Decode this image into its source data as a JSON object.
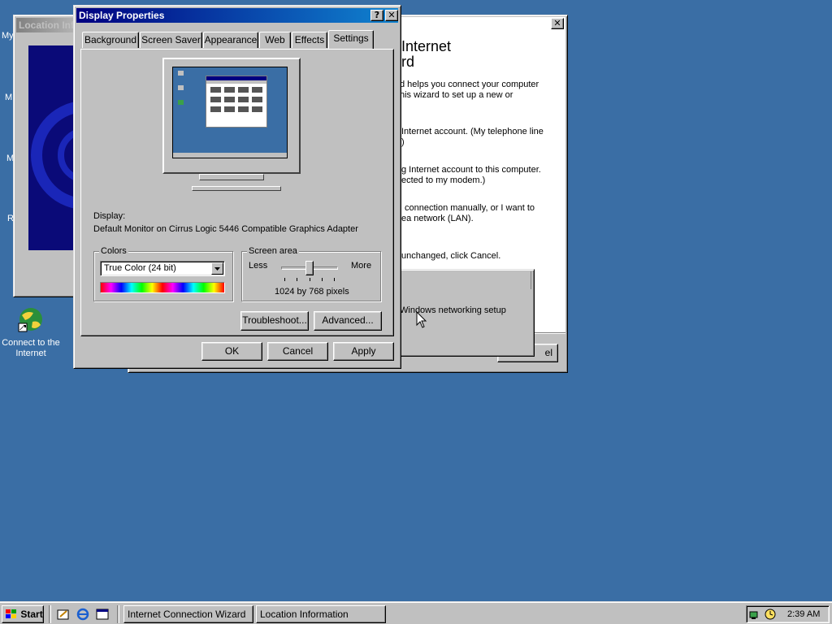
{
  "desktop": {
    "background_color": "#3a6ea5",
    "partial_icon_letters": [
      "My",
      "M",
      "M",
      "R"
    ],
    "icons": [
      {
        "label_line1": "Connect to the",
        "label_line2": "Internet"
      }
    ]
  },
  "location_window": {
    "title": "Location Inf"
  },
  "wizard_window": {
    "heading_line1": "Internet",
    "heading_line2": "rd",
    "lines": [
      "d helps you connect your computer",
      "his wizard to set up a new or",
      "Internet account. (My telephone line",
      ")",
      "g Internet account to this computer.",
      "ected to my modem.)",
      "connection manually, or I want to",
      "ea network (LAN).",
      "unchanged, click Cancel."
    ],
    "cancel_fragment": "el",
    "close_glyph": "✕"
  },
  "popup": {
    "text": "Windows networking setup"
  },
  "display_properties": {
    "title": "Display Properties",
    "help_glyph": "?",
    "close_glyph": "✕",
    "tabs": [
      "Background",
      "Screen Saver",
      "Appearance",
      "Web",
      "Effects",
      "Settings"
    ],
    "active_tab": "Settings",
    "display_label": "Display:",
    "display_value": "Default Monitor on Cirrus Logic 5446 Compatible Graphics Adapter",
    "colors": {
      "label": "Colors",
      "selected": "True Color (24 bit)"
    },
    "screen_area": {
      "label": "Screen area",
      "less": "Less",
      "more": "More",
      "value_text": "1024 by 768 pixels",
      "slider_fraction": 0.5
    },
    "buttons": {
      "troubleshoot": "Troubleshoot...",
      "advanced": "Advanced...",
      "ok": "OK",
      "cancel": "Cancel",
      "apply": "Apply"
    }
  },
  "taskbar": {
    "start_label": "Start",
    "tasks": [
      "Internet Connection Wizard",
      "Location Information"
    ],
    "clock": "2:39 AM"
  }
}
